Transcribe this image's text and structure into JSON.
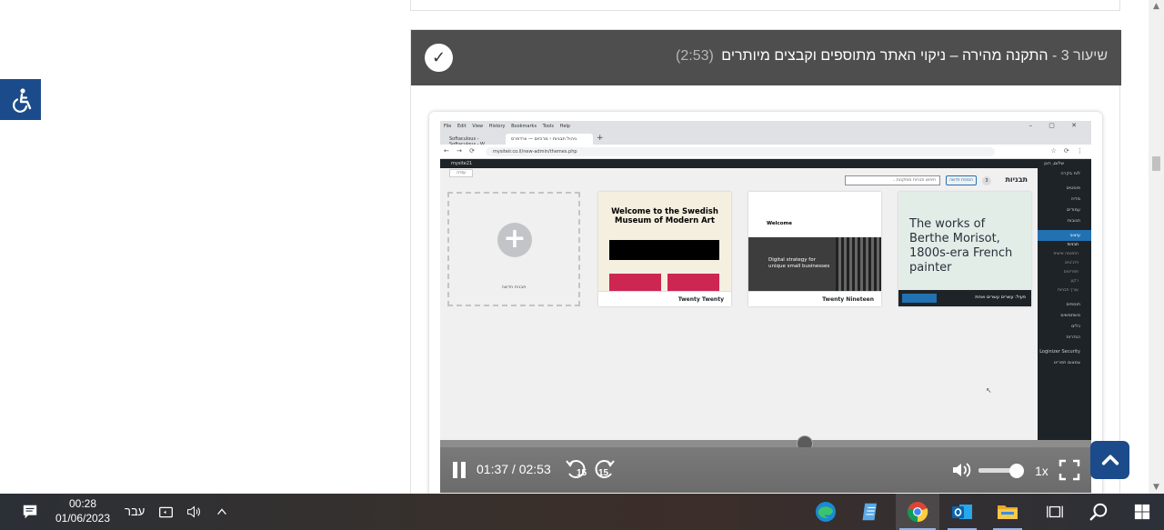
{
  "lesson": {
    "prefix": "שיעור 3 -",
    "title": "התקנה מהירה – ניקוי האתר מתוספים וקבצים מיותרים",
    "duration": "(2:53)",
    "check_glyph": "✓"
  },
  "browser": {
    "menu": [
      "File",
      "Edit",
      "View",
      "History",
      "Bookmarks",
      "Tools",
      "Help"
    ],
    "window_controls": "– ▢ ✕",
    "tabs": [
      "Softaculous - Softaculous - W...",
      "ניהול תבניות ‹ מרכזים — וורדפרס"
    ],
    "new_tab": "+",
    "url": "mysiteir.co.il/new-admin/themes.php",
    "nav_glyphs": "← → ⟳",
    "tool_glyphs": "☆ ⟳ ⋮"
  },
  "wp": {
    "adminbar_left": "mysite21",
    "adminbar_right": "שלום, רונן",
    "sidebar": [
      {
        "label": "לוח בקרה",
        "type": "item"
      },
      {
        "label": "פוסטים",
        "type": "item",
        "gap": true
      },
      {
        "label": "מדיה",
        "type": "item"
      },
      {
        "label": "עמודים",
        "type": "item"
      },
      {
        "label": "תגובות",
        "type": "item"
      },
      {
        "label": "עיצוב",
        "type": "active",
        "gap": true
      },
      {
        "label": "תבניות",
        "type": "sub-current"
      },
      {
        "label": "התאמה אישית",
        "type": "sub"
      },
      {
        "label": "וידג'טים",
        "type": "sub"
      },
      {
        "label": "תפריטים",
        "type": "sub"
      },
      {
        "label": "רקע",
        "type": "sub"
      },
      {
        "label": "עורך תבניות",
        "type": "sub"
      },
      {
        "label": "תוספים",
        "type": "item",
        "gap": true
      },
      {
        "label": "משתמשים",
        "type": "item"
      },
      {
        "label": "כלים",
        "type": "item"
      },
      {
        "label": "הגדרות",
        "type": "item"
      },
      {
        "label": "Loginizer Security",
        "type": "item",
        "gap": true
      },
      {
        "label": "צמצום תפריט",
        "type": "item"
      }
    ],
    "page_title": "תבניות",
    "theme_count": "3",
    "add_new_button": "הוספת חדשה",
    "search_placeholder": "חיפוש תבניות מותקנות...",
    "upload_button": "עזרה",
    "add_new_card_label": "תבנית חדשה",
    "themes": {
      "tt_heading": "Welcome to the Swedish Museum of Modern Art",
      "tt_name": "Twenty Twenty",
      "tn_heading": "Welcome",
      "tn_photo_text": "Digital strategy for unique small businesses",
      "tn_name": "Twenty Nineteen",
      "tb_heading": "The works of Berthe Morisot, 1800s-era French painter",
      "tb_footer": "פעיל: עשרים עשרים ואחת"
    }
  },
  "player": {
    "time": "01:37 / 02:53",
    "speed": "1x",
    "progress_fraction": 0.56,
    "volume_fraction": 0.8,
    "skip_back": "15",
    "skip_fwd": "15"
  },
  "taskbar": {
    "time": "00:28",
    "date": "01/06/2023",
    "language": "עבר",
    "apps": [
      "edge-icon",
      "notepad-icon",
      "chrome-icon",
      "outlook-icon",
      "file-explorer-icon",
      "task-view-icon",
      "search-icon",
      "windows-start-icon"
    ]
  },
  "colors": {
    "header_bg": "#4e4e4e",
    "accent_blue": "#1b4b8a",
    "wp_blue": "#2271b1",
    "wp_dark": "#1d2327"
  }
}
